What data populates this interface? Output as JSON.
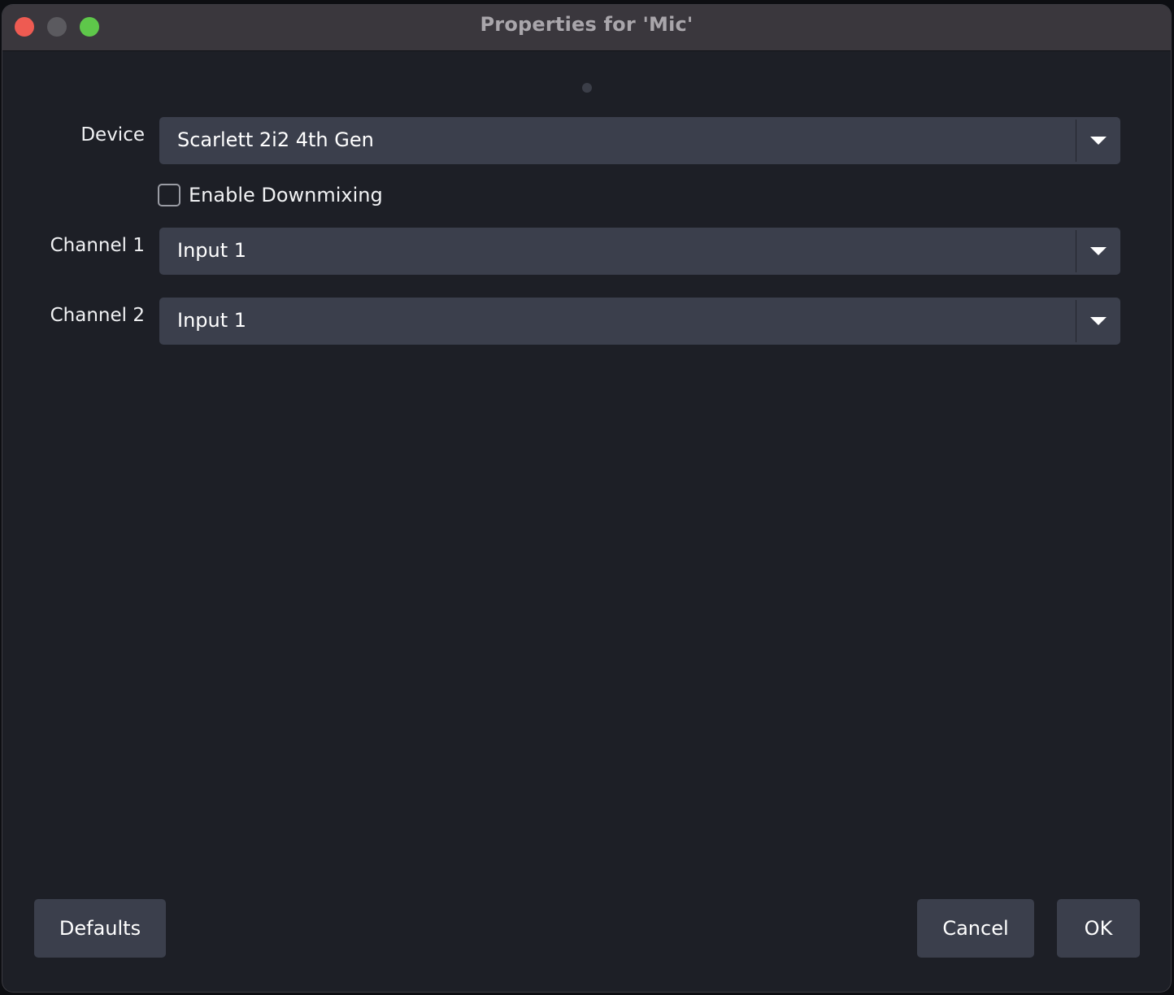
{
  "window": {
    "title": "Properties for 'Mic'"
  },
  "form": {
    "device": {
      "label": "Device",
      "value": "Scarlett 2i2 4th Gen"
    },
    "downmix": {
      "label": "Enable Downmixing",
      "checked": false
    },
    "channel1": {
      "label": "Channel 1",
      "value": "Input 1"
    },
    "channel2": {
      "label": "Channel 2",
      "value": "Input 1"
    }
  },
  "buttons": {
    "defaults": "Defaults",
    "cancel": "Cancel",
    "ok": "OK"
  },
  "colors": {
    "background": "#1d1f26",
    "control": "#3b3f4c",
    "titlebar": "#3a373d"
  },
  "icons": {
    "close": "close-traffic-light",
    "minimize": "minimize-traffic-light",
    "zoom": "zoom-traffic-light",
    "dropdown": "chevron-down-icon"
  }
}
